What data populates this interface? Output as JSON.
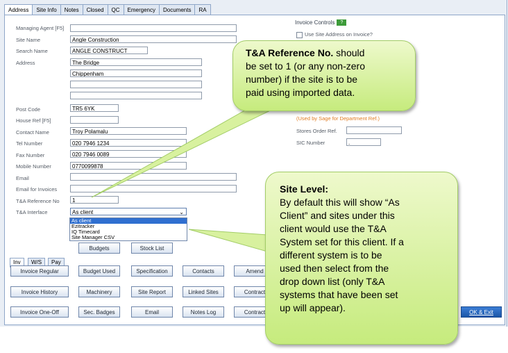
{
  "tabs": [
    "Address",
    "Site Info",
    "Notes",
    "Closed",
    "QC",
    "Emergency",
    "Documents",
    "RA"
  ],
  "fields": {
    "managing_agent": {
      "label": "Managing Agent [F5]",
      "value": ""
    },
    "site_name": {
      "label": "Site Name",
      "value": "Angle Construction"
    },
    "search_name": {
      "label": "Search Name",
      "value": "ANGLE CONSTRUCT"
    },
    "address": {
      "label": "Address",
      "lines": [
        "The Bridge",
        "Chippenham",
        "",
        ""
      ]
    },
    "post_code": {
      "label": "Post Code",
      "value": "TR5 6YK"
    },
    "house_ref": {
      "label": "House Ref [F5]",
      "value": ""
    },
    "contact_name": {
      "label": "Contact Name",
      "value": "Troy Polamalu"
    },
    "tel_number": {
      "label": "Tel Number",
      "value": "020 7946 1234"
    },
    "fax_number": {
      "label": "Fax Number",
      "value": "020 7946 0089"
    },
    "mobile_number": {
      "label": "Mobile Number",
      "value": "0770099878"
    },
    "email": {
      "label": "Email",
      "value": ""
    },
    "email_invoices": {
      "label": "Email for Invoices",
      "value": ""
    },
    "ta_reference": {
      "label": "T&A Reference No",
      "value": "1"
    },
    "ta_interface": {
      "label": "T&A Interface",
      "value": "As client",
      "options": [
        "As client",
        "Ezitracker",
        "IQ Timecard",
        "Site Manager CSV"
      ]
    }
  },
  "right_panel": {
    "invoice_controls": "Invoice Controls",
    "help": "?",
    "use_site_address": "Use Site Address on Invoice?",
    "sage_note": "(Used by Sage for Department Ref.)",
    "stores_order_ref": {
      "label": "Stores Order Ref.",
      "value": ""
    },
    "sic_number": {
      "label": "SIC Number",
      "value": "."
    }
  },
  "bottom_tabs": [
    "Inv",
    "W/S",
    "Pay"
  ],
  "buttons": {
    "col1": [
      "Invoice Regular",
      "Invoice History",
      "Invoice One-Off"
    ],
    "row0": [
      "Budgets",
      "Stock List"
    ],
    "row1": [
      "Budget Used",
      "Specification",
      "Contacts",
      "Amend"
    ],
    "row2": [
      "Machinery",
      "Site Report",
      "Linked Sites",
      "Contract"
    ],
    "row3": [
      "Sec. Badges",
      "Email",
      "Notes Log",
      "Contract"
    ],
    "ok_exit": "OK & Exit"
  },
  "callouts": {
    "ta_ref": {
      "bold": "T&A Reference No.",
      "lines": [
        " should",
        "be set to 1 (or any non-zero",
        "number) if the site is to be",
        "paid using imported data."
      ]
    },
    "site_level": {
      "bold": "Site Level:",
      "lines": [
        "By default this will show “As",
        "Client” and sites under this",
        "client would use the T&A",
        "System set for this client. If a",
        "different system is to be",
        "used then select from the",
        "drop down list (only T&A",
        "systems that have been set",
        "up will appear)."
      ]
    }
  },
  "colors": {
    "accent": "#2f6fd0",
    "callout_fill": "#d4f09a",
    "orange_note": "#e07a1f"
  }
}
